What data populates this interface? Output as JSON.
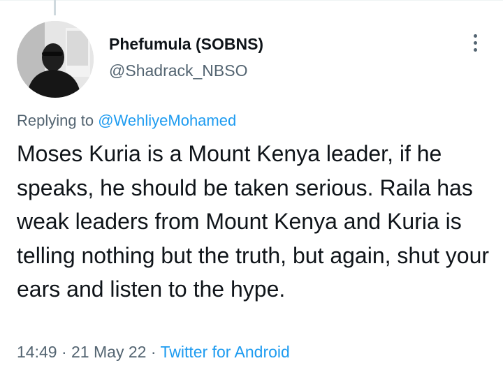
{
  "tweet": {
    "author": {
      "display_name": "Phefumula (SOBNS)",
      "handle": "@Shadrack_NBSO"
    },
    "replying_prefix": "Replying to",
    "replying_to": "@WehliyeMohamed",
    "text": "Moses Kuria is a Mount Kenya leader, if he speaks, he should be taken serious. Raila has weak leaders from Mount Kenya and Kuria is telling nothing but the truth, but again, shut your ears and listen to the hype.",
    "time": "14:49",
    "separator": "·",
    "date": "21 May 22",
    "source": "Twitter for Android"
  },
  "icons": {
    "more": "more-vertical-icon"
  },
  "colors": {
    "text": "#0f1419",
    "secondary": "#536471",
    "link": "#1d9bf0"
  }
}
